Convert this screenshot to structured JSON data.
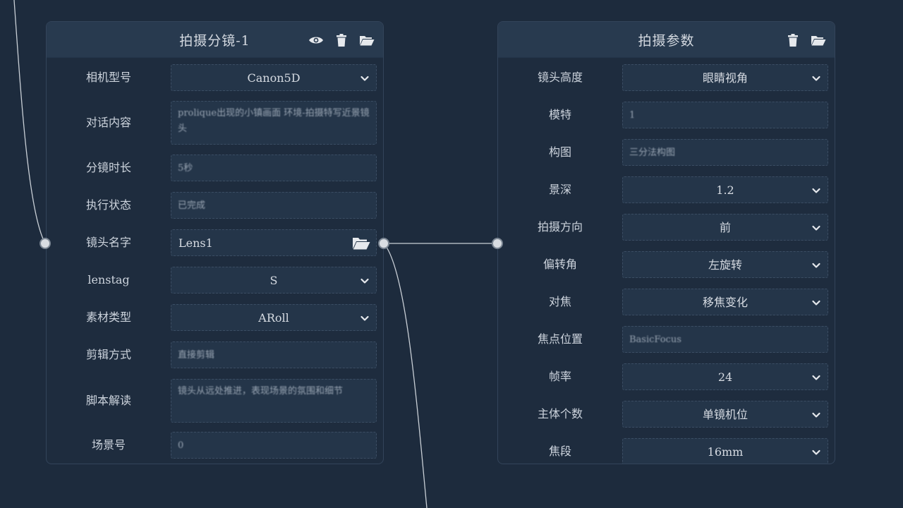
{
  "node_shot": {
    "title": "拍摄分镜-1",
    "icons": [
      "eye-icon",
      "trash-icon",
      "folder-open-icon"
    ],
    "fields": [
      {
        "label": "相机型号",
        "type": "select",
        "value": "Canon5D"
      },
      {
        "label": "对话内容",
        "type": "textarea",
        "value": "prolique出现的小镇画面 环境-拍摄特写近景镜头"
      },
      {
        "label": "分镜时长",
        "type": "text",
        "value": "5秒"
      },
      {
        "label": "执行状态",
        "type": "text",
        "value": "已完成"
      },
      {
        "label": "镜头名字",
        "type": "file",
        "value": "Lens1"
      },
      {
        "label": "lenstag",
        "type": "select",
        "value": "S"
      },
      {
        "label": "素材类型",
        "type": "select",
        "value": "ARoll"
      },
      {
        "label": "剪辑方式",
        "type": "text",
        "value": "直接剪辑"
      },
      {
        "label": "脚本解读",
        "type": "textarea",
        "value": "镜头从远处推进，表现场景的氛围和细节"
      },
      {
        "label": "场景号",
        "type": "text",
        "value": "0"
      }
    ]
  },
  "node_params": {
    "title": "拍摄参数",
    "icons": [
      "trash-icon",
      "folder-open-icon"
    ],
    "fields": [
      {
        "label": "镜头高度",
        "type": "select",
        "value": "眼睛视角"
      },
      {
        "label": "模特",
        "type": "text",
        "value": "1"
      },
      {
        "label": "构图",
        "type": "text",
        "value": "三分法构图"
      },
      {
        "label": "景深",
        "type": "select",
        "value": "1.2"
      },
      {
        "label": "拍摄方向",
        "type": "select",
        "value": "前"
      },
      {
        "label": "偏转角",
        "type": "select",
        "value": "左旋转"
      },
      {
        "label": "对焦",
        "type": "select",
        "value": "移焦变化"
      },
      {
        "label": "焦点位置",
        "type": "text",
        "value": "BasicFocus"
      },
      {
        "label": "帧率",
        "type": "select",
        "value": "24"
      },
      {
        "label": "主体个数",
        "type": "select",
        "value": "单镜机位"
      },
      {
        "label": "焦段",
        "type": "select",
        "value": "16mm"
      }
    ]
  },
  "colors": {
    "background": "#1d2b3d",
    "node_header": "#283a4f",
    "field_bg": "#243549",
    "wire": "#c9cfd6",
    "port": "#d9dde2"
  }
}
